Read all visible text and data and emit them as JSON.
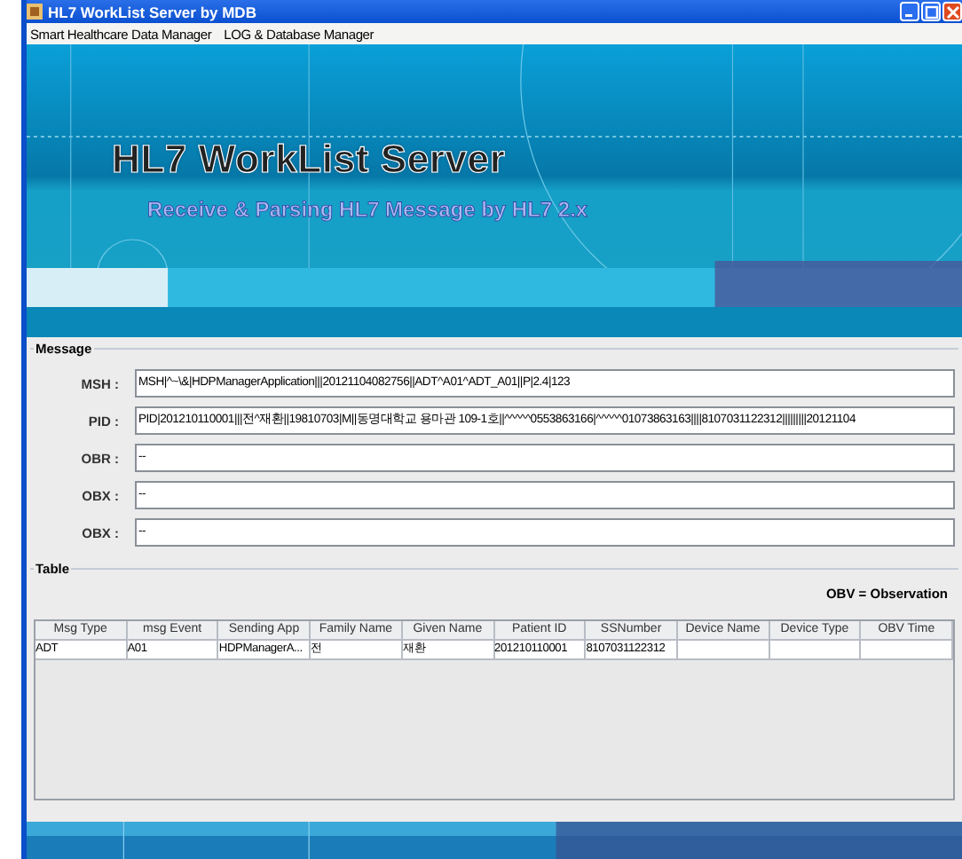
{
  "window": {
    "title": "HL7 WorkList Server by MDB"
  },
  "menu": [
    "Smart Healthcare Data Manager",
    "LOG & Database Manager"
  ],
  "banner": {
    "title": "HL7 WorkList Server",
    "subtitle": "Receive & Parsing HL7 Message by HL7 2.x"
  },
  "message": {
    "title": "Message",
    "fields": [
      {
        "label": "MSH :",
        "value": "MSH|^~\\&|HDPManagerApplication|||20121104082756||ADT^A01^ADT_A01||P|2.4|123"
      },
      {
        "label": "PID :",
        "value": "PID|201210110001|||전^재환||19810703|M||동명대학교 용마관 109-1호||^^^^^0553863166|^^^^^01073863163||||8107031122312|||||||||20121104"
      },
      {
        "label": "OBR :",
        "value": "--"
      },
      {
        "label": "OBX :",
        "value": "--"
      },
      {
        "label": "OBX :",
        "value": "--"
      }
    ]
  },
  "table": {
    "title": "Table",
    "legend": "OBV = Observation",
    "columns": [
      "Msg Type",
      "msg Event",
      "Sending App",
      "Family Name",
      "Given Name",
      "Patient ID",
      "SSNumber",
      "Device Name",
      "Device Type",
      "OBV Time"
    ],
    "rows": [
      [
        "ADT",
        "A01",
        "HDPManagerA...",
        "전",
        "재환",
        "201210110001",
        "8107031122312",
        "",
        "",
        ""
      ]
    ]
  }
}
